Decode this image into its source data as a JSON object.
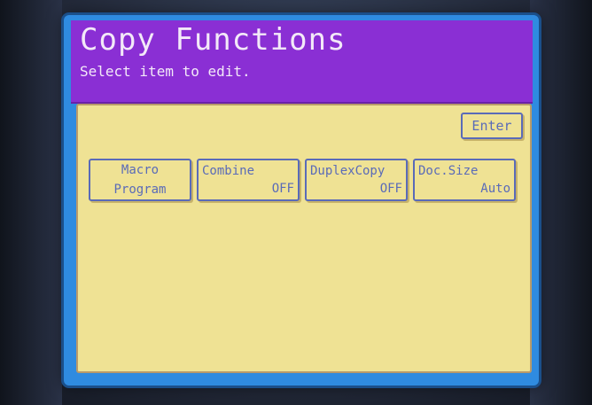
{
  "screen": {
    "title": "Copy Functions",
    "subtitle": "Select item to edit."
  },
  "enter_button": {
    "label": "Enter"
  },
  "functions": [
    {
      "line1": "Macro",
      "line2": "Program"
    },
    {
      "line1": "Combine",
      "line2": "OFF"
    },
    {
      "line1": "DuplexCopy",
      "line2": "OFF"
    },
    {
      "line1": "Doc.Size",
      "line2": "Auto"
    }
  ],
  "colors": {
    "header_bg": "#8a2fd4",
    "panel_bg": "#efe294",
    "button_border": "#5a6bb8",
    "screen_frame": "#2f8be0"
  }
}
